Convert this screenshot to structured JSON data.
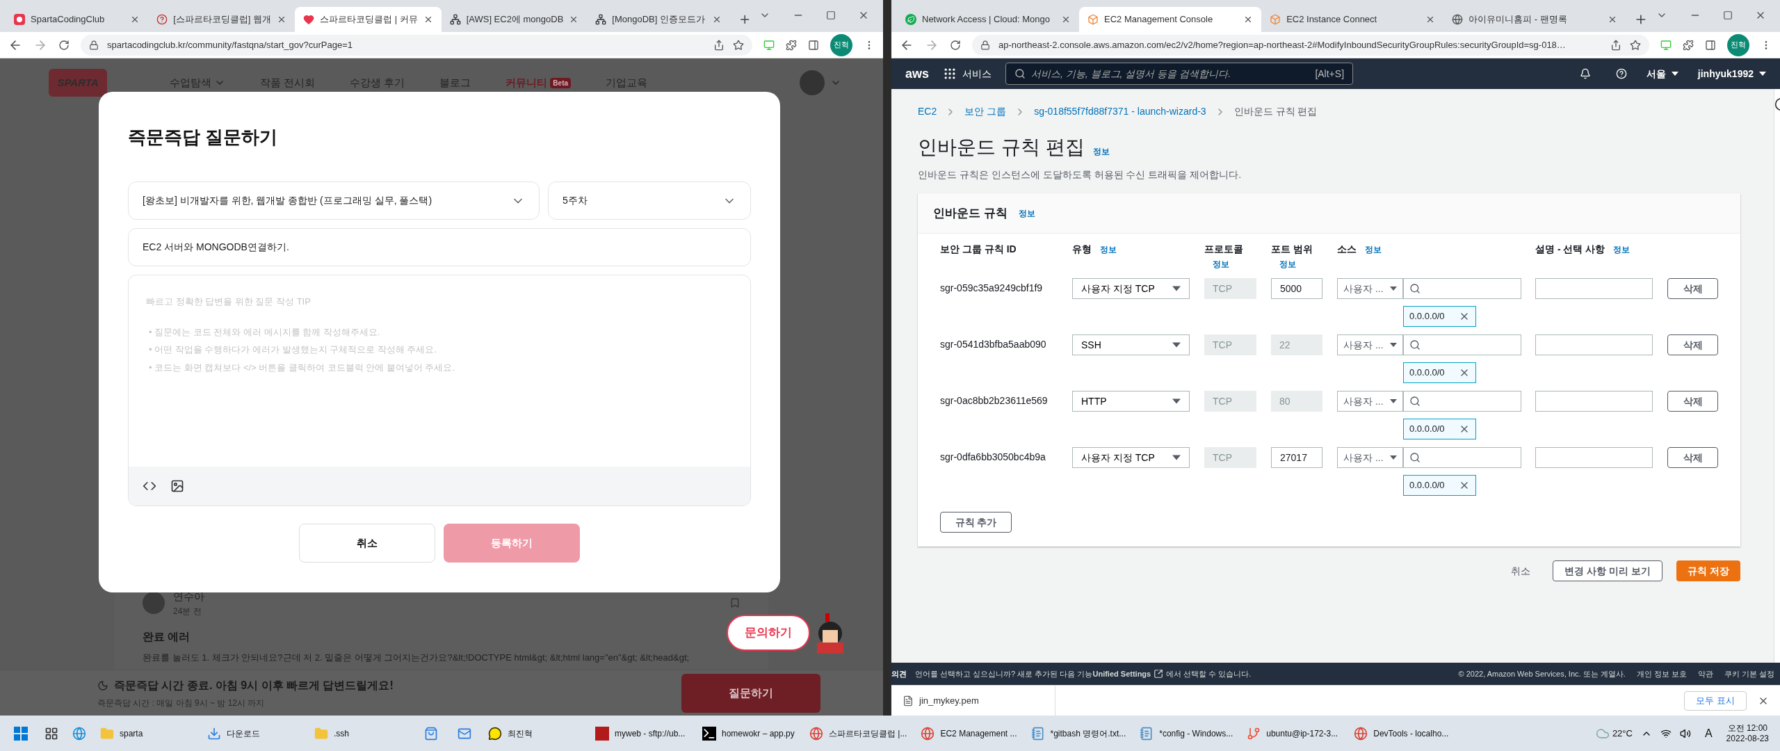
{
  "left_window": {
    "tabs": [
      {
        "kind": "sparta",
        "title": "SpartaCodingClub",
        "selected": false
      },
      {
        "kind": "question",
        "title": "[스파르타코딩클럽] 웹개",
        "selected": false
      },
      {
        "kind": "heart",
        "title": "스파르타코딩클럽 | 커뮤",
        "selected": true
      },
      {
        "kind": "dots",
        "title": "[AWS] EC2에 mongoDB",
        "selected": false
      },
      {
        "kind": "dots",
        "title": "[MongoDB] 인증모드가",
        "selected": false
      }
    ],
    "url": "spartacodingclub.kr/community/fastqna/start_gov?curPage=1",
    "profile": "진혁",
    "logo": "SPARTA",
    "nav": [
      {
        "label": "수업탐색",
        "dropdown": true,
        "selected": false
      },
      {
        "label": "작품 전시회",
        "dropdown": false,
        "selected": false
      },
      {
        "label": "수강생 후기",
        "dropdown": false,
        "selected": false
      },
      {
        "label": "블로그",
        "dropdown": false,
        "selected": false
      },
      {
        "label": "커뮤니티",
        "badge": "Beta",
        "dropdown": false,
        "selected": true
      },
      {
        "label": "기업교육",
        "dropdown": false,
        "selected": false
      }
    ],
    "modal": {
      "title": "즉문즉답 질문하기",
      "course": "[왕초보] 비개발자를 위한, 웹개발 종합반 (프로그래밍 실무, 풀스택)",
      "week": "5주차",
      "question_title": "EC2 서버와 MONGODB연결하기.",
      "tips_heading": "빠르고 정확한 답변을 위한 질문 작성 TIP",
      "tips": [
        "• 질문에는 코드 전체와 에러 메시지를 함께 작성해주세요.",
        "• 어떤 작업을 수행하다가 에러가 발생했는지 구체적으로 작성해 주세요.",
        "• 코드는 화면 캡쳐보다 </> 버튼을 클릭하여 코드블럭 안에 붙여넣어 주세요."
      ],
      "cancel": "취소",
      "submit": {
        "label": "등록하기",
        "disabled": true
      }
    },
    "post": {
      "author": "연수아",
      "time": "24분 전",
      "title": "완료 에러",
      "body": "완료를 눌러도 1. 체크가 안되네요?근데 저 2. 밑줄은 어떻게 그어지는건가요?&lt;!DOCTYPE html&gt; &lt;html lang=\"en\"&gt; &lt;head&gt;"
    },
    "help_button": "문의하기",
    "bottom_bar": {
      "notice": "즉문즉답 시간 종료. 아침 9시 이후 빠르게 답변드릴게요!",
      "hours": "즉문즉답 시간 : 매일 아침 9시 ~ 밤 12시 까지",
      "button": "질문하기"
    }
  },
  "right_window": {
    "tabs": [
      {
        "kind": "leaf",
        "title": "Network Access | Cloud: Mongo",
        "selected": false
      },
      {
        "kind": "cube",
        "title": "EC2 Management Console",
        "selected": true
      },
      {
        "kind": "cube",
        "title": "EC2 Instance Connect",
        "selected": false
      },
      {
        "kind": "globe",
        "title": "아이유미니홈피 - 팬명록",
        "selected": false
      }
    ],
    "url": "ap-northeast-2.console.aws.amazon.com/ec2/v2/home?region=ap-northeast-2#ModifyInboundSecurityGroupRules:securityGroupId=sg-018…",
    "profile": "진혁",
    "aws_nav": {
      "logo": "aws",
      "services": "서비스",
      "search_placeholder": "서비스, 기능, 블로그, 설명서 등을 검색합니다.",
      "shortcut": "[Alt+S]",
      "region": "서울",
      "user": "jinhyuk1992"
    },
    "breadcrumb": [
      {
        "label": "EC2",
        "link": true
      },
      {
        "label": "보안 그룹",
        "link": true
      },
      {
        "label": "sg-018f55f7fd88f7371 - launch-wizard-3",
        "link": true
      },
      {
        "label": "인바운드 규칙 편집",
        "link": false
      }
    ],
    "heading": "인바운드 규칙 편집",
    "heading_info": "정보",
    "description": "인바운드 규칙은 인스턴스에 도달하도록 허용된 수신 트래픽을 제어합니다.",
    "panel": {
      "title": "인바운드 규칙",
      "info": "정보",
      "columns": [
        {
          "label": "보안 그룹 규칙 ID"
        },
        {
          "label": "유형",
          "info": "정보"
        },
        {
          "label": "프로토콜",
          "info": "정보"
        },
        {
          "label": "포트 범위",
          "info": "정보"
        },
        {
          "label": "소스",
          "info": "정보"
        },
        {
          "label": "설명 - 선택 사항",
          "info": "정보"
        }
      ],
      "rows": [
        {
          "id": "sgr-059c35a9249cbf1f9",
          "type": "사용자 지정 TCP",
          "protocol": "TCP",
          "port": "5000",
          "port_disabled": false,
          "source": "사용자 ...",
          "cidr": "0.0.0.0/0",
          "delete": "삭제"
        },
        {
          "id": "sgr-0541d3bfba5aab090",
          "type": "SSH",
          "protocol": "TCP",
          "port": "22",
          "port_disabled": true,
          "source": "사용자 ...",
          "cidr": "0.0.0.0/0",
          "delete": "삭제"
        },
        {
          "id": "sgr-0ac8bb2b23611e569",
          "type": "HTTP",
          "protocol": "TCP",
          "port": "80",
          "port_disabled": true,
          "source": "사용자 ...",
          "cidr": "0.0.0.0/0",
          "delete": "삭제"
        },
        {
          "id": "sgr-0dfa6bb3050bc4b9a",
          "type": "사용자 지정 TCP",
          "protocol": "TCP",
          "port": "27017",
          "port_disabled": false,
          "source": "사용자 ...",
          "cidr": "0.0.0.0/0",
          "delete": "삭제"
        }
      ],
      "add_button": "규칙 추가"
    },
    "actions": {
      "cancel": "취소",
      "preview": "변경 사항 미리 보기",
      "save": "규칙 저장"
    },
    "footer": {
      "feedback": "의견",
      "language_before": "언어를 선택하고 싶으십니까? 새로 추가된 다음 기능**Unified Settings**",
      "language_after": "에서 선택할 수 있습니다.",
      "copyright": "© 2022, Amazon Web Services, Inc. 또는 계열사.",
      "links": [
        "개인 정보 보호",
        "약관",
        "쿠키 기본 설정"
      ]
    },
    "download_bar": {
      "file": "jin_mykey.pem",
      "show_all": "모두 표시"
    }
  },
  "taskbar": {
    "items": [
      {
        "kind": "folder",
        "label": "sparta"
      },
      {
        "kind": "download",
        "label": "다운로드"
      },
      {
        "kind": "folder",
        "label": ".ssh"
      },
      {
        "kind": "store"
      },
      {
        "kind": "mail"
      },
      {
        "kind": "chat",
        "label": "최진혁"
      },
      {
        "kind": "ftp",
        "label": "myweb - sftp://ub..."
      },
      {
        "kind": "ide",
        "label": "homewokr – app.py"
      },
      {
        "kind": "browser",
        "label": "스파르타코딩클럽 |..."
      },
      {
        "kind": "browser",
        "label": "EC2 Management ..."
      },
      {
        "kind": "notepad",
        "label": "*gitbash 명령어.txt..."
      },
      {
        "kind": "notepad",
        "label": "*config - Windows..."
      },
      {
        "kind": "git",
        "label": "ubuntu@ip-172-3..."
      },
      {
        "kind": "browser",
        "label": "DevTools - localho..."
      }
    ],
    "weather": "22°C",
    "ime": "A",
    "time": "오전 12:00",
    "date": "2022-08-23"
  }
}
